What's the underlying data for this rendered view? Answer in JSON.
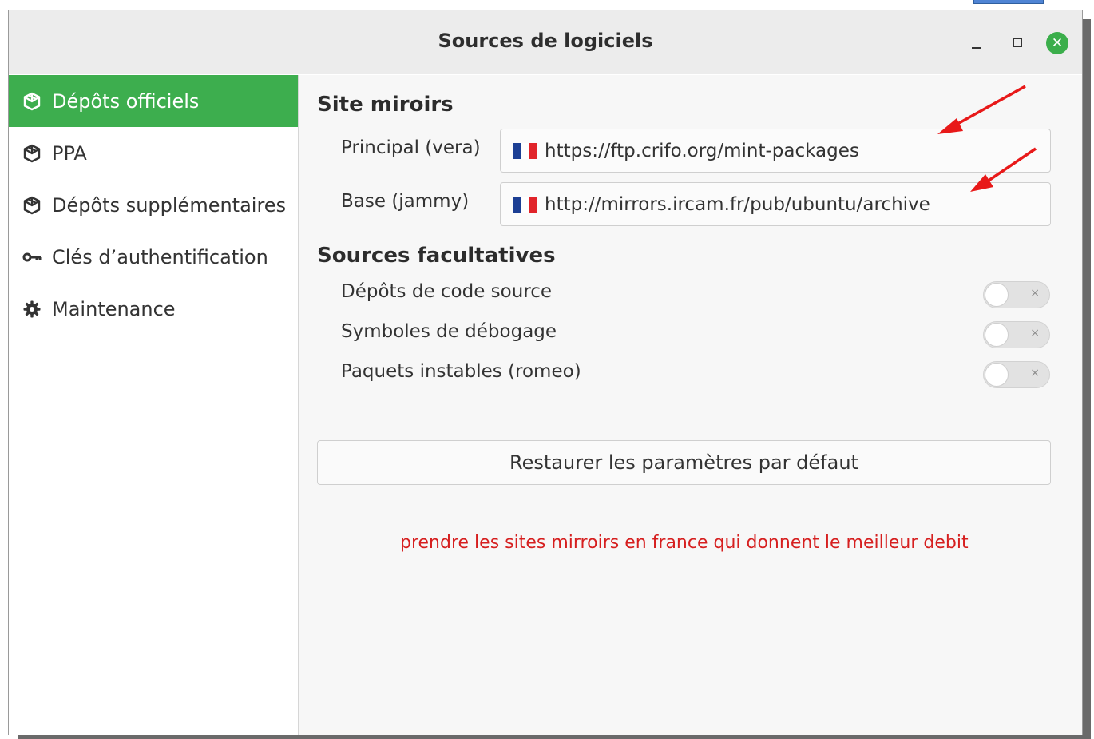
{
  "window": {
    "title": "Sources de logiciels",
    "controls": {
      "minimize": "–",
      "maximize": "□",
      "close": "✕"
    }
  },
  "sidebar": {
    "items": [
      {
        "label": "Dépôts officiels",
        "icon": "package-icon",
        "active": true
      },
      {
        "label": "PPA",
        "icon": "package-icon",
        "active": false
      },
      {
        "label": "Dépôts supplémentaires",
        "icon": "package-icon",
        "active": false
      },
      {
        "label": "Clés d’authentification",
        "icon": "key-icon",
        "active": false
      },
      {
        "label": "Maintenance",
        "icon": "gear-icon",
        "active": false
      }
    ]
  },
  "mirrors": {
    "title": "Site miroirs",
    "rows": [
      {
        "label": "Principal (vera)",
        "url": "https://ftp.crifo.org/mint-packages",
        "flag": "france-flag-icon"
      },
      {
        "label": "Base (jammy)",
        "url": "http://mirrors.ircam.fr/pub/ubuntu/archive",
        "flag": "france-flag-icon"
      }
    ]
  },
  "optional_sources": {
    "title": "Sources facultatives",
    "items": [
      {
        "label": "Dépôts de code source",
        "enabled": false
      },
      {
        "label": "Symboles de débogage",
        "enabled": false
      },
      {
        "label": "Paquets instables (romeo)",
        "enabled": false
      }
    ],
    "toggle_off_glyph": "×"
  },
  "restore_button": {
    "label": "Restaurer les paramètres par défaut"
  },
  "annotation": {
    "note": "prendre les sites mirroirs en france qui donnent le meilleur debit",
    "color": "#d61f1f"
  },
  "colors": {
    "accent": "#3dae4e",
    "close_button": "#3bae4b",
    "flag_blue": "#1c3f94",
    "flag_white": "#ffffff",
    "flag_red": "#e1242a"
  }
}
